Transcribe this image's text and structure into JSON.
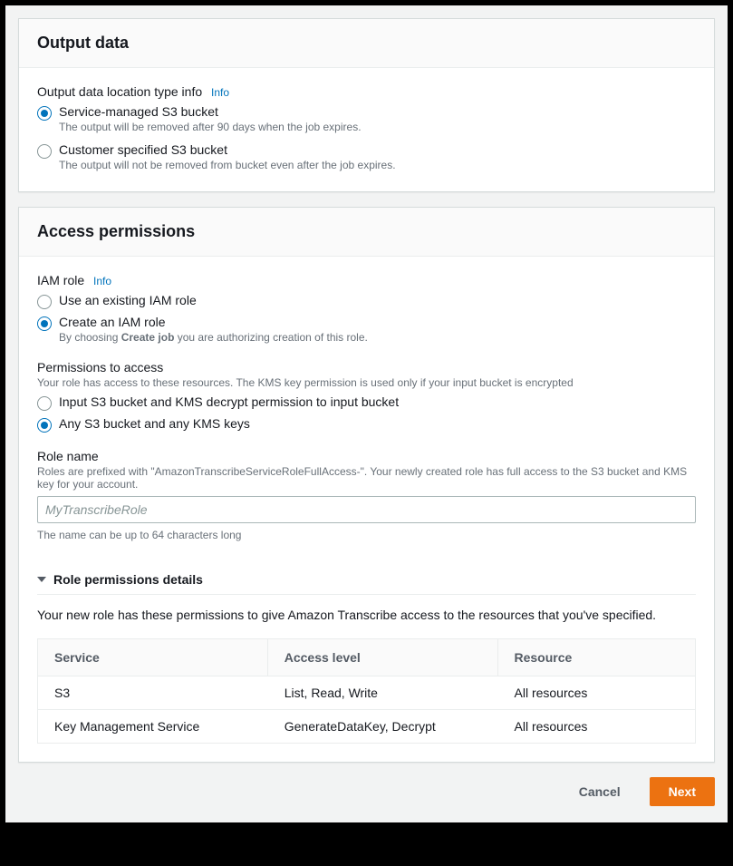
{
  "outputData": {
    "title": "Output data",
    "locationTypeLabel": "Output data location type info",
    "infoLink": "Info",
    "options": [
      {
        "title": "Service-managed S3 bucket",
        "desc": "The output will be removed after 90 days when the job expires.",
        "selected": true
      },
      {
        "title": "Customer specified S3 bucket",
        "desc": "The output will not be removed from bucket even after the job expires.",
        "selected": false
      }
    ]
  },
  "accessPermissions": {
    "title": "Access permissions",
    "iamRoleLabel": "IAM role",
    "infoLink": "Info",
    "iamOptions": [
      {
        "title": "Use an existing IAM role",
        "selected": false
      },
      {
        "title": "Create an IAM role",
        "selected": true
      }
    ],
    "createRoleDesc": {
      "pre": "By choosing ",
      "bold": "Create job",
      "post": " you are authorizing creation of this role."
    },
    "permsLabel": "Permissions to access",
    "permsHelper": "Your role has access to these resources. The KMS key permission is used only if your input bucket is encrypted",
    "permsOptions": [
      {
        "title": "Input S3 bucket and KMS decrypt permission to input bucket",
        "selected": false
      },
      {
        "title": "Any S3 bucket and any KMS keys",
        "selected": true
      }
    ],
    "roleName": {
      "label": "Role name",
      "helper": "Roles are prefixed with \"AmazonTranscribeServiceRoleFullAccess-\". Your newly created role has full access to the S3 bucket and KMS key for your account.",
      "placeholder": "MyTranscribeRole",
      "value": "",
      "constraint": "The name can be up to 64 characters long"
    },
    "details": {
      "header": "Role permissions details",
      "desc": "Your new role has these permissions to give Amazon Transcribe access to the resources that you've specified.",
      "columns": [
        "Service",
        "Access level",
        "Resource"
      ],
      "rows": [
        {
          "service": "S3",
          "access": "List, Read, Write",
          "resource": "All resources"
        },
        {
          "service": "Key Management Service",
          "access": "GenerateDataKey, Decrypt",
          "resource": "All resources"
        }
      ]
    }
  },
  "footer": {
    "cancel": "Cancel",
    "next": "Next"
  }
}
